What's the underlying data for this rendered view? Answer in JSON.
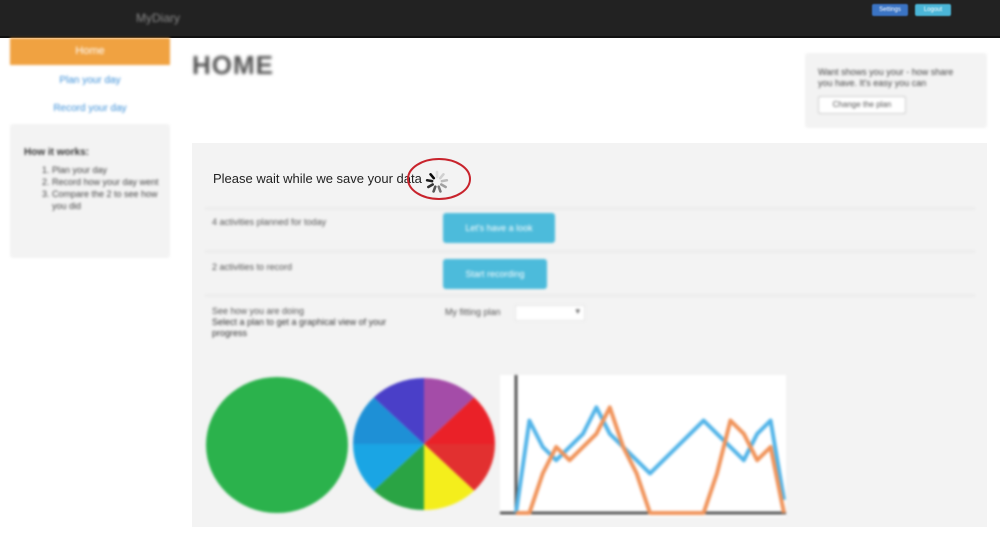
{
  "topbar": {
    "brand": "MyDiary",
    "buttons": [
      "Settings",
      "Logout"
    ]
  },
  "sidebar": {
    "active_item": "Home",
    "links": [
      "Plan your day",
      "Record your day"
    ],
    "steps": {
      "title": "How it works:",
      "items": [
        "Plan your day",
        "Record how your day went",
        "Compare the 2 to see how you did"
      ]
    }
  },
  "page_title": "HOME",
  "info_box": {
    "text": "Want shows you your - how share you have. It's easy you can",
    "button": "Change the plan"
  },
  "status": {
    "wait_message": "Please wait while we save your data"
  },
  "rows": [
    {
      "label": "4 activities planned for today",
      "button": "Let's have a look"
    },
    {
      "label": "2 activities to record",
      "button": "Start recording"
    }
  ],
  "progress": {
    "label_line1": "See how you are doing",
    "label_line2": "Select a plan to get a graphical view of your progress",
    "select_value": "My fitting plan"
  },
  "colors": {
    "topbar": "#222222",
    "accent_orange": "#f0a241",
    "button_cyan": "#4cbbdb",
    "link_blue": "#3b8fd8",
    "annotation_red": "#c8232c"
  },
  "chart_data": [
    {
      "type": "pie",
      "slices": [
        {
          "color": "#2bb24c",
          "value": 100
        }
      ]
    },
    {
      "type": "pie",
      "slices": [
        {
          "color": "#a44ca8",
          "value": 1
        },
        {
          "color": "#ea2128",
          "value": 1
        },
        {
          "color": "#e23030",
          "value": 1
        },
        {
          "color": "#f4ee1c",
          "value": 1
        },
        {
          "color": "#2aa444",
          "value": 1
        },
        {
          "color": "#1aa5e4",
          "value": 1
        },
        {
          "color": "#1e90d6",
          "value": 1
        },
        {
          "color": "#4a3fc8",
          "value": 1
        }
      ]
    },
    {
      "type": "line",
      "x": [
        0,
        1,
        2,
        3,
        4,
        5,
        6,
        7,
        8,
        9,
        10,
        11,
        12,
        13,
        14,
        15,
        16,
        17,
        18,
        19,
        20
      ],
      "ylim": [
        0,
        10
      ],
      "series": [
        {
          "color": "#52b4e8",
          "values": [
            0,
            7,
            5,
            4,
            5,
            6,
            8,
            6,
            5,
            4,
            3,
            4,
            5,
            6,
            7,
            6,
            5,
            4,
            6,
            7,
            1
          ]
        },
        {
          "color": "#f0935a",
          "values": [
            0,
            0,
            3,
            5,
            4,
            5,
            6,
            8,
            5,
            3,
            0,
            0,
            0,
            0,
            0,
            3,
            7,
            6,
            4,
            5,
            0
          ]
        }
      ]
    }
  ]
}
